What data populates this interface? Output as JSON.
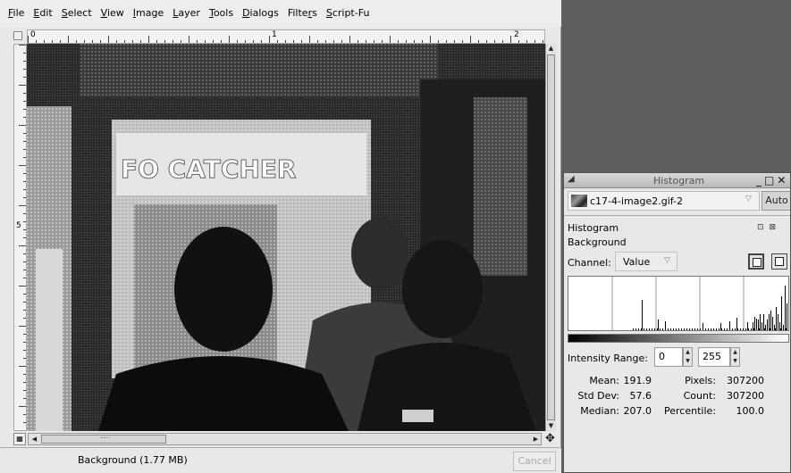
{
  "menu": [
    "File",
    "Edit",
    "Select",
    "View",
    "Image",
    "Layer",
    "Tools",
    "Dialogs",
    "Filters",
    "Script-Fu"
  ],
  "menu_mnemonics": [
    "F",
    "E",
    "S",
    "V",
    "I",
    "L",
    "T",
    "D",
    "r",
    "S"
  ],
  "ruler": {
    "h_labels": [
      "0",
      "1",
      "2"
    ],
    "v_labels": [
      "5"
    ]
  },
  "scroll": {
    "hdots": "...."
  },
  "status": {
    "label": "Background (1.77 MB)",
    "cancel": "Cancel"
  },
  "histogram_dialog": {
    "window_title": "Histogram",
    "image_name": "c17-4-image2.gif-2",
    "auto_label": "Auto",
    "heading": "Histogram",
    "layer": "Background",
    "channel_label": "Channel:",
    "channel_value": "Value",
    "intensity_label": "Intensity Range:",
    "range_low": "0",
    "range_high": "255",
    "stats": {
      "mean_label": "Mean:",
      "mean": "191.9",
      "std_label": "Std Dev:",
      "std": "57.6",
      "median_label": "Median:",
      "median": "207.0",
      "pixels_label": "Pixels:",
      "pixels": "307200",
      "count_label": "Count:",
      "count": "307200",
      "percentile_label": "Percentile:",
      "percentile": "100.0"
    }
  },
  "colors": {
    "accent": "#000000",
    "workspace": "#5e5e5e",
    "histogram_bar": "#000000"
  }
}
